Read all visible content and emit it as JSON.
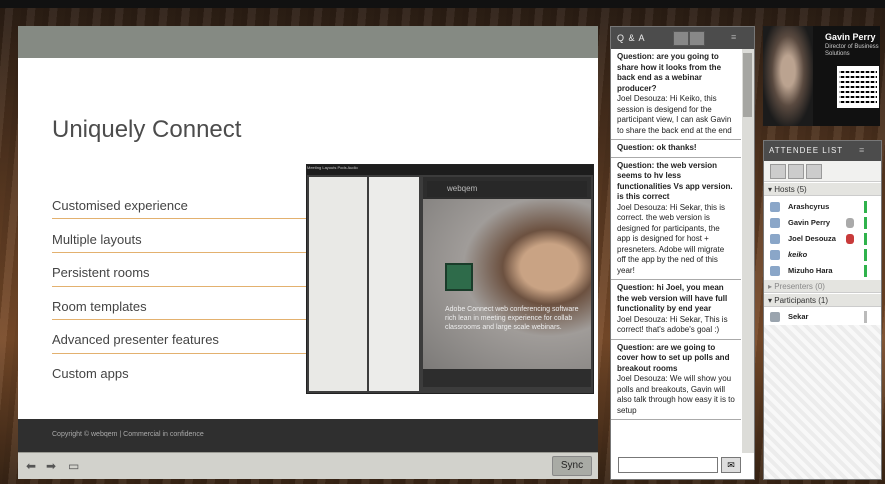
{
  "slide": {
    "title": "Uniquely Connect",
    "features": [
      "Customised experience",
      "Multiple layouts",
      "Persistent rooms",
      "Room templates",
      "Advanced presenter features",
      "Custom apps"
    ],
    "footer": "Copyright © webqem  |  Commercial in confidence"
  },
  "share_controls": {
    "sync_label": "Sync",
    "prev_icon": "arrow-left-icon",
    "next_icon": "arrow-right-icon",
    "fullscreen_icon": "fullscreen-icon"
  },
  "embedded": {
    "menu": "Meeting  Layouts  Pods  Audio",
    "brand": "webqem",
    "caption": "Adobe Connect web conferencing software rich lean in meeting experience for collab classrooms and large scale webinars."
  },
  "qa": {
    "title": "Q & A",
    "items": [
      {
        "q": "Question: are you going to share how it looks from the back end as a webinar producer?",
        "a": "Joel Desouza: Hi Keiko, this session is desigend for the participant view, I can ask Gavin to share the back end at the end"
      },
      {
        "q": "Question: ok  thanks!",
        "a": ""
      },
      {
        "q": "Question: the web version seems to hv less functionalities Vs app version. is this correct",
        "a": "Joel Desouza: Hi Sekar, this is correct. the web version is designed for participants, the app is designed for host + presneters. Adobe will migrate off the app by the ned of this year!"
      },
      {
        "q": "Question: hi Joel, you mean the web version will have full functionality by end year",
        "a": "Joel Desouza: Hi Sekar, This is correct! that's adobe's goal :)"
      },
      {
        "q": "Question: are we going to cover how to set up polls and breakout rooms",
        "a": "Joel Desouza: We will show you polls and breakouts, Gavin will also talk through how easy it is to setup"
      }
    ]
  },
  "profile": {
    "name": "Gavin Perry",
    "role": "Director of Business Solutions"
  },
  "attendees": {
    "title": "ATTENDEE LIST",
    "hosts_label": "Hosts (5)",
    "hosts": [
      {
        "name": "Arashcyrus"
      },
      {
        "name": "Gavin Perry"
      },
      {
        "name": "Joel Desouza"
      },
      {
        "name": "keiko"
      },
      {
        "name": "Mizuho Hara"
      }
    ],
    "presenters_label": "Presenters (0)",
    "participants_label": "Participants (1)",
    "participants": [
      {
        "name": "Sekar"
      }
    ]
  },
  "colors": {
    "status_active": "#2fb24c",
    "accent_line": "#e3b16f",
    "pod_header": "#4c4c4c"
  }
}
